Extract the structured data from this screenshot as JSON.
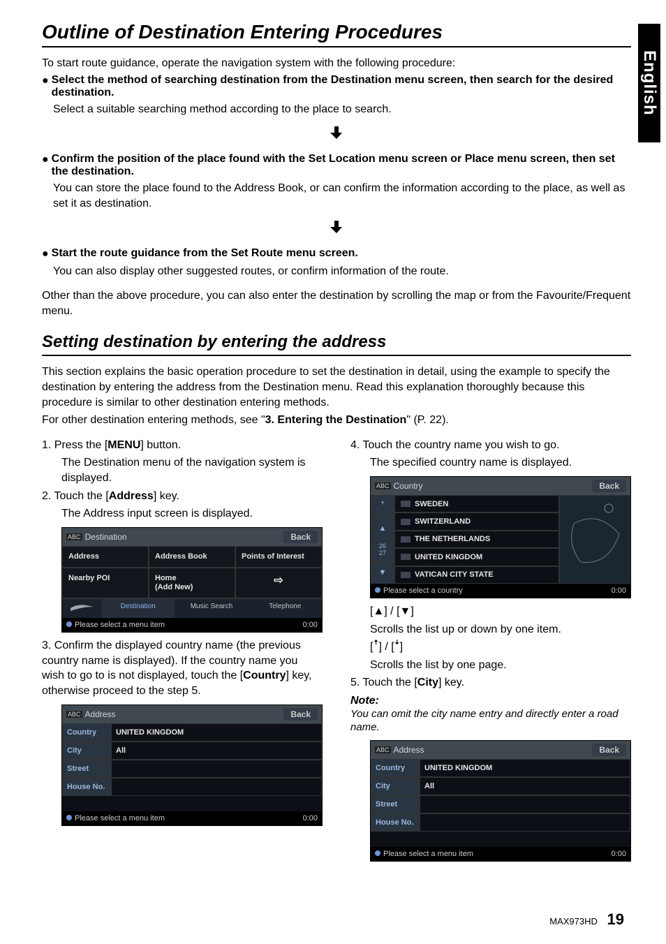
{
  "lang_tab": "English",
  "title_main": "Outline of Destination Entering Procedures",
  "intro_para": "To start route guidance, operate the navigation system with the following procedure:",
  "b1_head": "Select the method of searching destination from the Destination menu screen, then search for the desired destination.",
  "b1_body": "Select a suitable searching method according to the place to search.",
  "b2_head": "Confirm the position of the place found with the Set Location menu screen or Place menu screen, then set the destination.",
  "b2_body": "You can store the place found to the Address Book, or can confirm the information according to the place, as well as set it as destination.",
  "b3_head": "Start the route guidance from the Set Route menu screen.",
  "b3_body": "You can also display other suggested routes, or confirm information of the route.",
  "outro_para": "Other than the above procedure, you can also enter the destination by scrolling the map or from the Favourite/Frequent menu.",
  "title_sub": "Setting destination by entering the address",
  "sub_para1": "This section explains the basic operation procedure to set the destination in detail, using the example to specify the destination by entering the address from the Destination menu. Read this explanation thoroughly because this procedure is similar to other destination entering methods.",
  "sub_para2_pre": "For other destination entering methods, see \"",
  "sub_para2_bold": "3. Entering the Destination",
  "sub_para2_post": "\" (P. 22).",
  "step1a": "1.  Press the [",
  "step1_key": "MENU",
  "step1b": "] button.",
  "step1_body": "The Destination menu of the navigation system is displayed.",
  "step2a": "2.  Touch the [",
  "step2_key": "Address",
  "step2b": "] key.",
  "step2_body": "The Address input screen is displayed.",
  "step3a": "3.  Confirm the displayed country name (the previous country name is displayed). If the country name you wish to go to is not displayed, touch the [",
  "step3_key": "Country",
  "step3b": "] key, otherwise proceed to the step 5.",
  "step4a": "4.  Touch the country name you wish to go.",
  "step4_body": "The specified country name is displayed.",
  "scroll_sym1": "[▲] / [▼]",
  "scroll_t1": "Scrolls the list up or down by one item.",
  "scroll_sym2": "[ꜛ] / [ꜜ]",
  "scroll_t2": "Scrolls the list by one page.",
  "step5a": "5.  Touch the [",
  "step5_key": "City",
  "step5b": "] key.",
  "note_head": "Note:",
  "note_body": "You can omit the city name entry and directly enter a road name.",
  "shot1": {
    "title": "Destination",
    "back": "Back",
    "cells": [
      "Address",
      "Address Book",
      "Points of Interest",
      "Nearby POI",
      "Home\n(Add New)",
      "⇨"
    ],
    "tabs": [
      "",
      "Destination",
      "Music Search",
      "Telephone"
    ],
    "footer_msg": "Please select a menu item",
    "time": "0:00"
  },
  "shot2": {
    "title": "Address",
    "back": "Back",
    "rows": [
      {
        "lab": "Country",
        "val": "UNITED KINGDOM"
      },
      {
        "lab": "City",
        "val": "All"
      },
      {
        "lab": "Street",
        "val": ""
      },
      {
        "lab": "House No.",
        "val": ""
      }
    ],
    "footer_msg": "Please select a menu item",
    "time": "0:00"
  },
  "shot3": {
    "title": "Country",
    "back": "Back",
    "sides": [
      "ꜛ",
      "▲",
      "26\n27",
      "▼"
    ],
    "items": [
      "SWEDEN",
      "SWITZERLAND",
      "THE NETHERLANDS",
      "UNITED KINGDOM",
      "VATICAN CITY STATE"
    ],
    "footer_msg": "Please select a country",
    "time": "0:00"
  },
  "shot4": {
    "title": "Address",
    "back": "Back",
    "rows": [
      {
        "lab": "Country",
        "val": "UNITED KINGDOM"
      },
      {
        "lab": "City",
        "val": "All"
      },
      {
        "lab": "Street",
        "val": ""
      },
      {
        "lab": "House No.",
        "val": ""
      }
    ],
    "footer_msg": "Please select a menu item",
    "time": "0:00"
  },
  "footer_model": "MAX973HD",
  "footer_page": "19"
}
